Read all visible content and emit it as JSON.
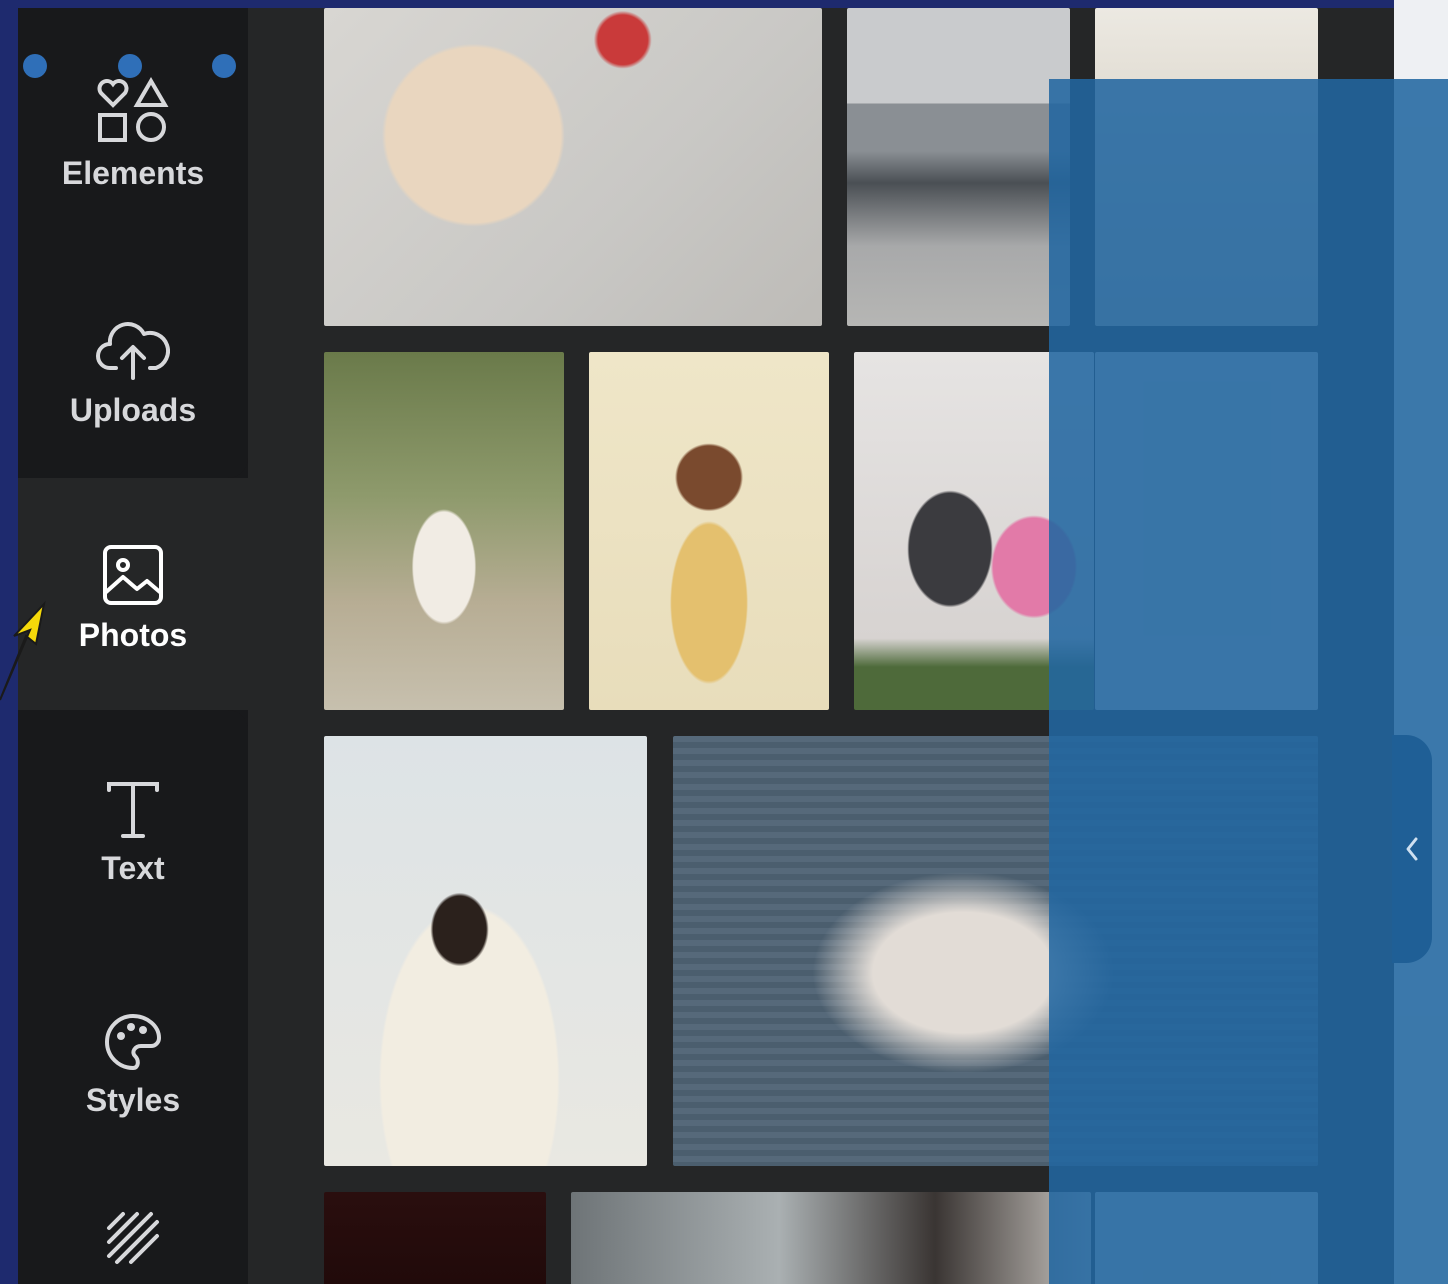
{
  "sidebar": {
    "items": [
      {
        "label": "Elements",
        "icon": "elements-icon"
      },
      {
        "label": "Uploads",
        "icon": "upload-cloud-icon"
      },
      {
        "label": "Photos",
        "icon": "photo-icon",
        "active": true
      },
      {
        "label": "Text",
        "icon": "text-t-icon"
      },
      {
        "label": "Styles",
        "icon": "palette-icon"
      },
      {
        "label": "",
        "icon": "background-hatch-icon"
      }
    ]
  },
  "colors": {
    "frame": "#1e2a6e",
    "sidebar": "#18191b",
    "panel": "#252627",
    "overlay": "#2267a0",
    "accent_yellow": "#f5d90a"
  }
}
